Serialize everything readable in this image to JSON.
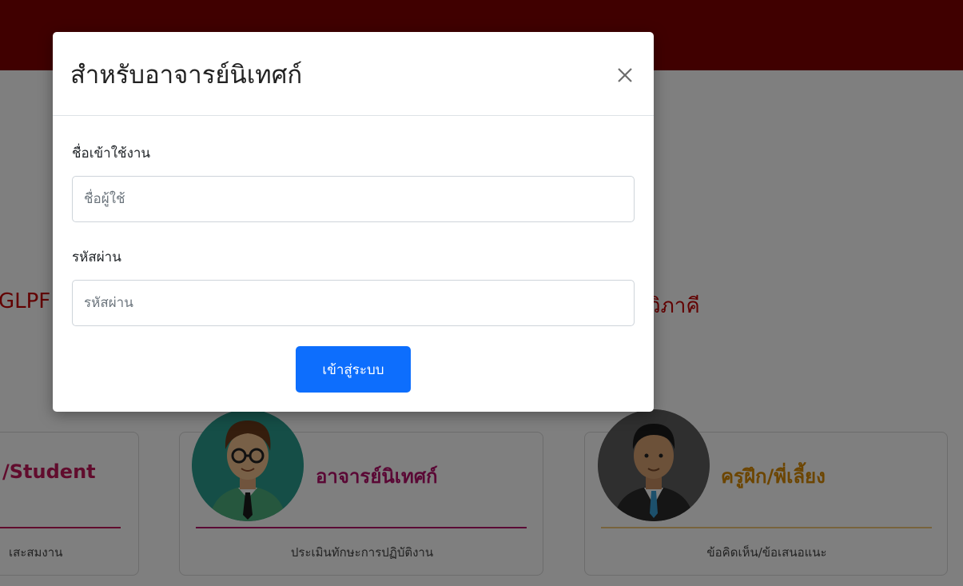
{
  "background": {
    "section_title_left": "GLPF",
    "section_title_right": "วิภาคี",
    "cards": [
      {
        "title": "/Student",
        "description": "เสะสมงาน"
      },
      {
        "title": "อาจารย์นิเทศก์",
        "description": "ประเมินทักษะการปฏิบัติงาน"
      },
      {
        "title": "ครูฝึก/พี่เลี้ยง",
        "description": "ข้อคิดเห็น/ข้อเสนอแนะ"
      }
    ]
  },
  "modal": {
    "title": "สำหรับอาจารย์นิเทศก์",
    "close_icon": "close-icon",
    "username": {
      "label": "ชื่อเข้าใช้งาน",
      "placeholder": "ชื่อผู้ใช้",
      "value": ""
    },
    "password": {
      "label": "รหัสผ่าน",
      "placeholder": "รหัสผ่าน",
      "value": ""
    },
    "submit_label": "เข้าสู่ระบบ"
  },
  "colors": {
    "topbar": "#800000",
    "primary_button": "#0d6efd",
    "student_accent": "#c2185b",
    "supervisor_accent": "#b5116b",
    "mentor_accent": "#d88a00"
  }
}
